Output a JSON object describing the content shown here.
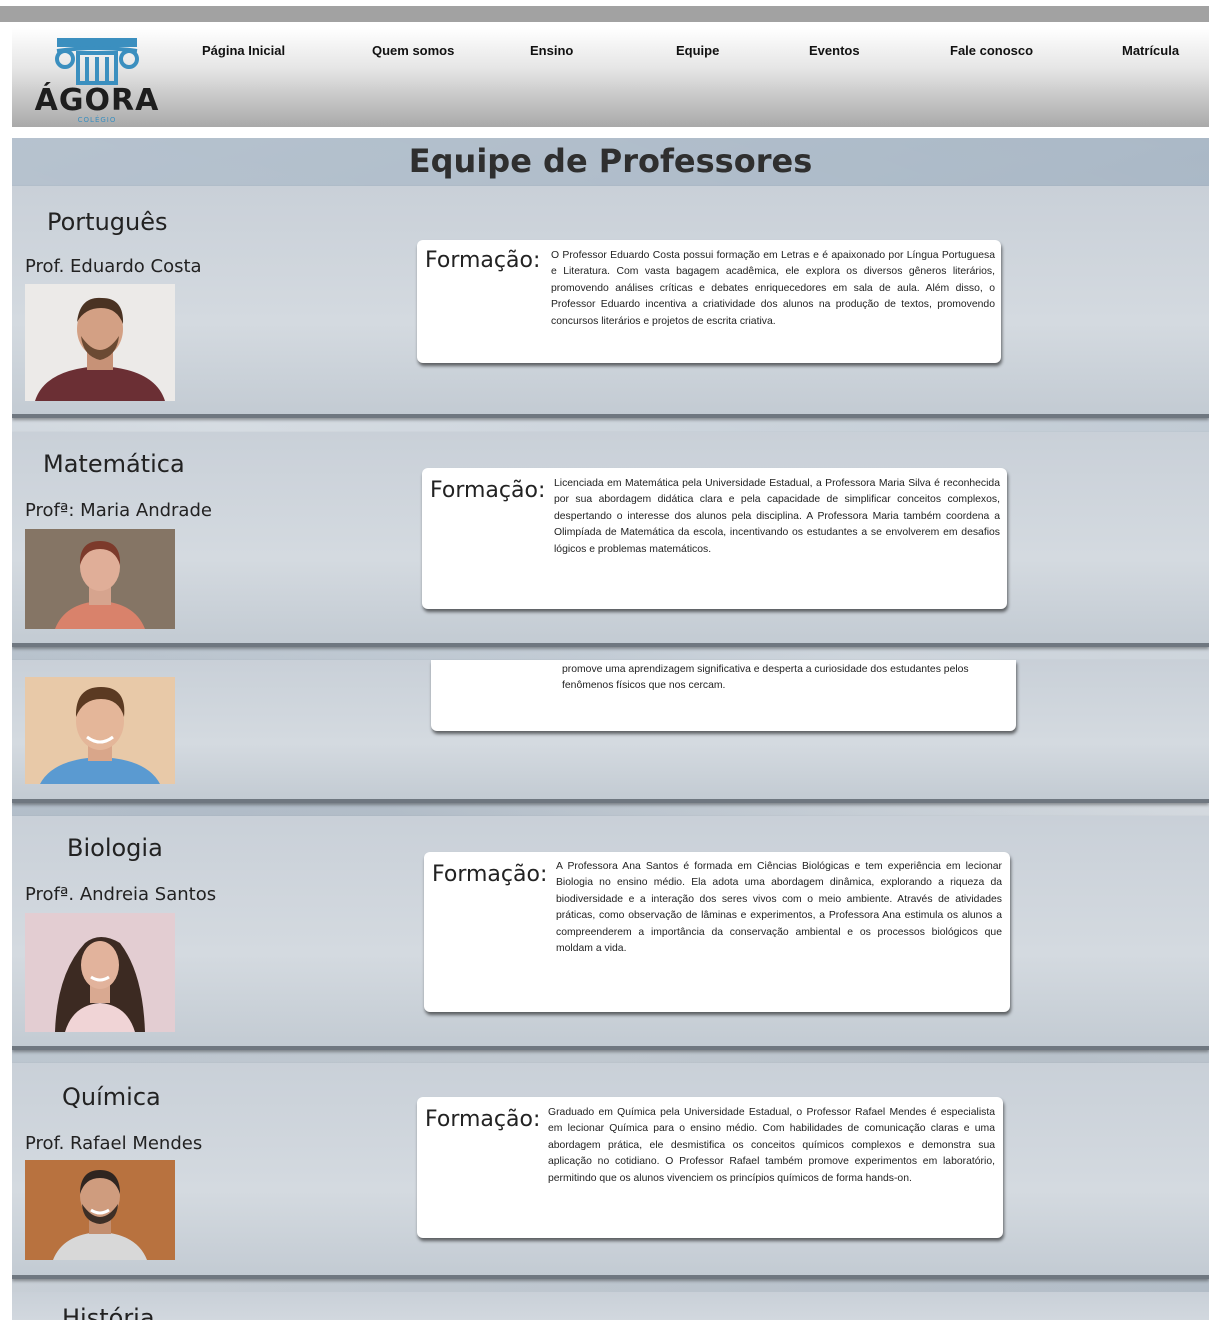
{
  "brand": {
    "name": "ÁGORA",
    "tagline": "COLÉGIO",
    "logo_color": "#3b8fbf"
  },
  "nav": {
    "items": [
      {
        "label": "Página Inicial"
      },
      {
        "label": "Quem somos"
      },
      {
        "label": "Ensino"
      },
      {
        "label": "Equipe"
      },
      {
        "label": "Eventos"
      },
      {
        "label": "Fale conosco"
      },
      {
        "label": "Matrícula"
      }
    ]
  },
  "page": {
    "title": "Equipe de Professores"
  },
  "sections": [
    {
      "subject": "Português",
      "teacher": "Prof. Eduardo Costa",
      "label": "Formação:",
      "text": "O Professor Eduardo Costa possui formação em Letras e é apaixonado por Língua Portuguesa e Literatura. Com vasta bagagem acadêmica, ele explora os diversos gêneros literários, promovendo análises críticas e debates enriquecedores em sala de aula. Além disso, o Professor Eduardo incentiva a criatividade dos alunos na produção de textos, promovendo concursos literários e projetos de escrita criativa."
    },
    {
      "subject": "Matemática",
      "teacher": "Profª: Maria Andrade",
      "label": "Formação:",
      "text": "Licenciada em Matemática pela Universidade Estadual, a Professora Maria Silva é reconhecida por sua abordagem didática clara e pela capacidade de simplificar conceitos complexos, despertando o interesse dos alunos pela disciplina. A Professora Maria também coordena a Olimpíada de Matemática da escola, incentivando os estudantes a se envolverem em desafios lógicos e problemas matemáticos."
    },
    {
      "subject": "",
      "teacher": "",
      "label": "",
      "text": "promove uma aprendizagem significativa e desperta a curiosidade dos estudantes pelos fenômenos físicos que nos cercam."
    },
    {
      "subject": "Biologia",
      "teacher": "Profª. Andreia Santos",
      "label": "Formação:",
      "text": "A Professora Ana Santos é formada em Ciências Biológicas e tem experiência em lecionar Biologia no ensino médio. Ela adota uma abordagem dinâmica, explorando a riqueza da biodiversidade e a interação dos seres vivos com o meio ambiente. Através de atividades práticas, como observação de lâminas e experimentos, a Professora Ana estimula os alunos a compreenderem a importância da conservação ambiental e os processos biológicos que moldam a vida."
    },
    {
      "subject": "Química",
      "teacher": "Prof. Rafael Mendes",
      "label": "Formação:",
      "text": "Graduado em Química pela Universidade Estadual, o Professor Rafael Mendes é especialista em lecionar Química para o ensino médio. Com habilidades de comunicação claras e uma abordagem prática, ele desmistifica os conceitos químicos complexos e demonstra sua aplicação no cotidiano. O Professor Rafael também promove experimentos em laboratório, permitindo que os alunos vivenciem os princípios químicos de forma hands-on."
    },
    {
      "subject": "História",
      "teacher": "",
      "label": "",
      "text": ""
    }
  ]
}
